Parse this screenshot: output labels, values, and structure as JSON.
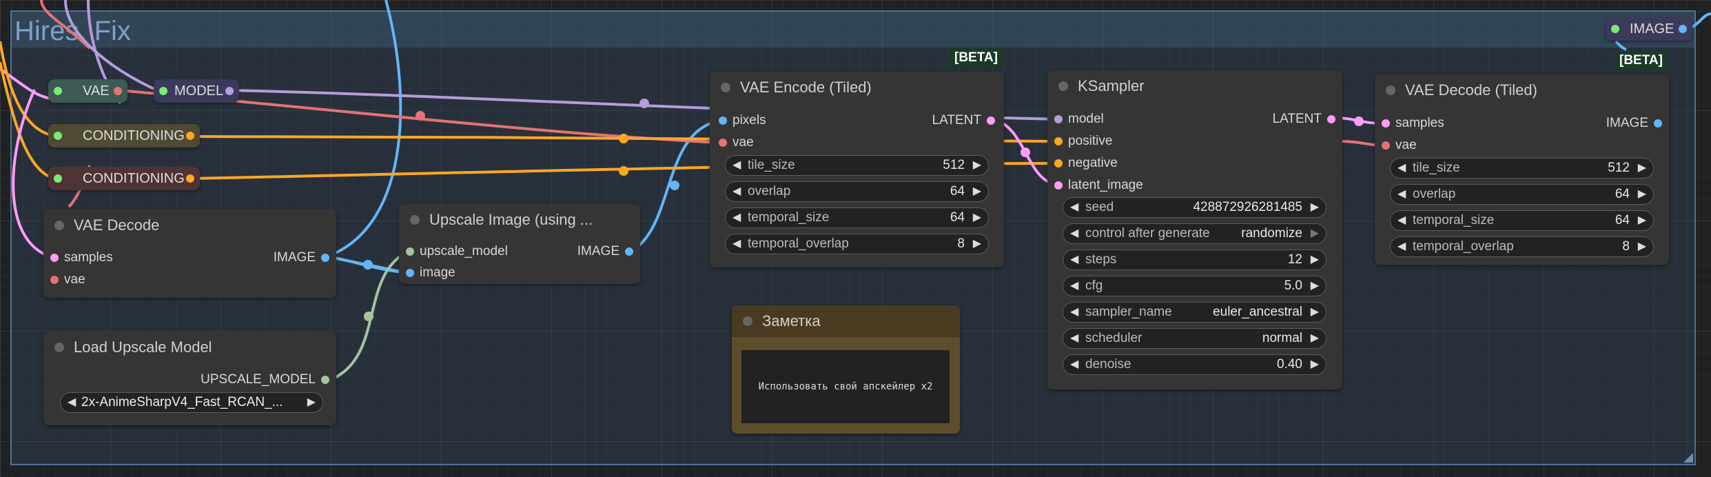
{
  "group": {
    "title": "Hires. Fix"
  },
  "beta_badges": [
    "[BETA]",
    "[BETA]"
  ],
  "top_right_pill": {
    "label": "IMAGE"
  },
  "pills": {
    "vae": "VAE",
    "model": "MODEL",
    "conditioning_1": "CONDITIONING",
    "conditioning_2": "CONDITIONING"
  },
  "vae_decode": {
    "title": "VAE Decode",
    "inputs": [
      "samples",
      "vae"
    ],
    "output": "IMAGE"
  },
  "load_upscale_model": {
    "title": "Load Upscale Model",
    "output": "UPSCALE_MODEL",
    "model_name": "2x-AnimeSharpV4_Fast_RCAN_..."
  },
  "upscale_image": {
    "title": "Upscale Image (using ...",
    "inputs": [
      "upscale_model",
      "image"
    ],
    "output": "IMAGE"
  },
  "vae_encode_tiled": {
    "title": "VAE Encode (Tiled)",
    "inputs": [
      "pixels",
      "vae"
    ],
    "output": "LATENT",
    "widgets": [
      {
        "label": "tile_size",
        "value": "512"
      },
      {
        "label": "overlap",
        "value": "64"
      },
      {
        "label": "temporal_size",
        "value": "64"
      },
      {
        "label": "temporal_overlap",
        "value": "8"
      }
    ]
  },
  "ksampler": {
    "title": "KSampler",
    "inputs": [
      "model",
      "positive",
      "negative",
      "latent_image"
    ],
    "output": "LATENT",
    "widgets": [
      {
        "label": "seed",
        "value": "428872926281485"
      },
      {
        "label": "control after generate",
        "value": "randomize"
      },
      {
        "label": "steps",
        "value": "12"
      },
      {
        "label": "cfg",
        "value": "5.0"
      },
      {
        "label": "sampler_name",
        "value": "euler_ancestral"
      },
      {
        "label": "scheduler",
        "value": "normal"
      },
      {
        "label": "denoise",
        "value": "0.40"
      }
    ]
  },
  "vae_decode_tiled": {
    "title": "VAE Decode (Tiled)",
    "inputs": [
      "samples",
      "vae"
    ],
    "output": "IMAGE",
    "widgets": [
      {
        "label": "tile_size",
        "value": "512"
      },
      {
        "label": "overlap",
        "value": "64"
      },
      {
        "label": "temporal_size",
        "value": "64"
      },
      {
        "label": "temporal_overlap",
        "value": "8"
      }
    ]
  },
  "note": {
    "title": "Заметка",
    "text": "Использовать свой апскейлер x2"
  },
  "colors": {
    "model": "#b39ddb",
    "vae": "#e57373",
    "conditioning": "#ffa726",
    "latent": "#ff9cf9",
    "image": "#64b5f6",
    "upscale_model": "#a5c4a0",
    "clip": "#ffd500"
  }
}
